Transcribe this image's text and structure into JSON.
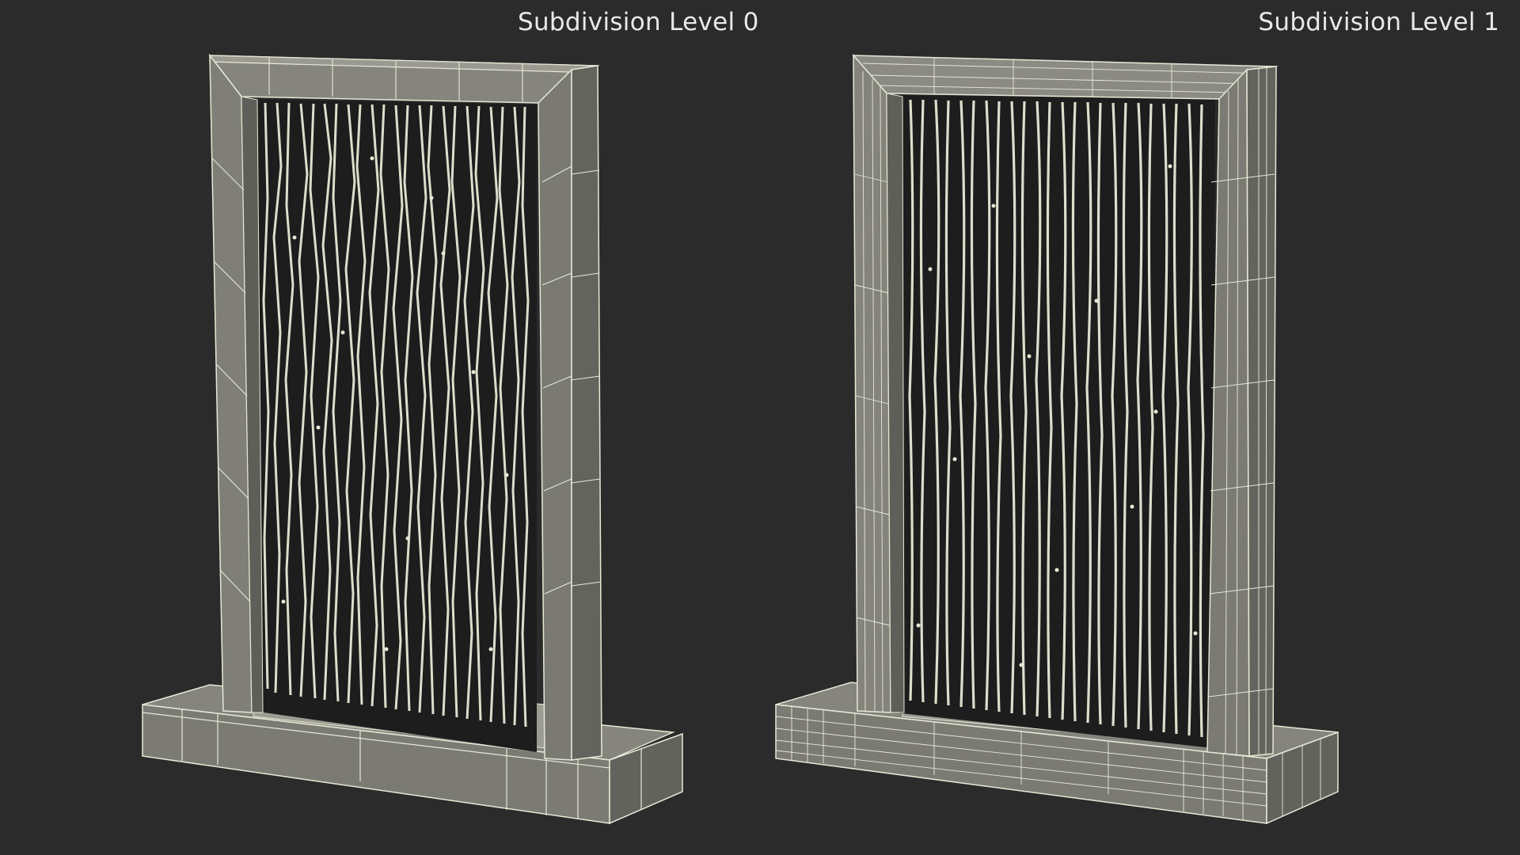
{
  "render": {
    "left_label": "Subdivision Level 0",
    "right_label": "Subdivision Level 1"
  },
  "colors": {
    "background": "#2b2b2b",
    "surface_light": "#8f8f87",
    "surface_mid": "#76766f",
    "surface_dark": "#5e5e58",
    "wire": "#e8e8d6",
    "interior": "#1d1d1d"
  }
}
